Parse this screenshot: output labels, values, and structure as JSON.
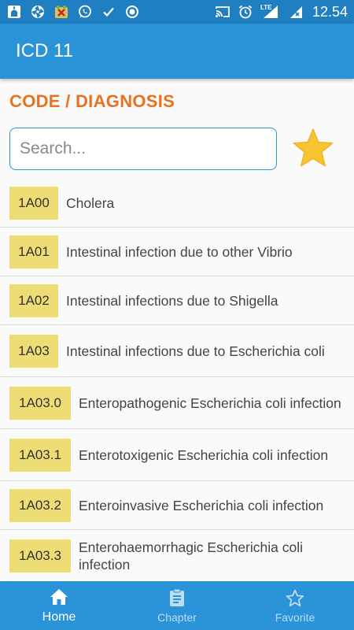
{
  "status_bar": {
    "time": "12.54",
    "network_label": "LTE",
    "icons": [
      "mosque-icon",
      "aperture-icon",
      "game-icon",
      "whatsapp-icon",
      "check-icon",
      "record-icon",
      "cast-icon",
      "alarm-icon",
      "signal-icon",
      "battery-icon"
    ]
  },
  "app_bar": {
    "title": "ICD 11"
  },
  "section": {
    "title": "CODE / DIAGNOSIS"
  },
  "search": {
    "placeholder": "Search...",
    "value": ""
  },
  "favorite": {
    "icon": "star-icon",
    "color": "#f7c531"
  },
  "list": {
    "items": [
      {
        "code": "1A00",
        "description": "Cholera"
      },
      {
        "code": "1A01",
        "description": "Intestinal infection due to other Vibrio"
      },
      {
        "code": "1A02",
        "description": "Intestinal infections due to Shigella"
      },
      {
        "code": "1A03",
        "description": "Intestinal infections due to Escherichia coli"
      },
      {
        "code": "1A03.0",
        "description": "Enteropathogenic Escherichia coli infection"
      },
      {
        "code": "1A03.1",
        "description": "Enterotoxigenic Escherichia coli infection"
      },
      {
        "code": "1A03.2",
        "description": "Enteroinvasive Escherichia coli infection"
      },
      {
        "code": "1A03.3",
        "description": "Enterohaemorrhagic Escherichia coli infection"
      }
    ]
  },
  "bottom_nav": {
    "items": [
      {
        "label": "Home",
        "icon": "home-icon",
        "active": true
      },
      {
        "label": "Chapter",
        "icon": "clipboard-icon",
        "active": false
      },
      {
        "label": "Favorite",
        "icon": "star-outline-icon",
        "active": false
      }
    ]
  },
  "colors": {
    "status_bar": "#1f7fc1",
    "primary": "#2b93d8",
    "accent": "#e8731e",
    "code_badge": "#eedc74"
  }
}
